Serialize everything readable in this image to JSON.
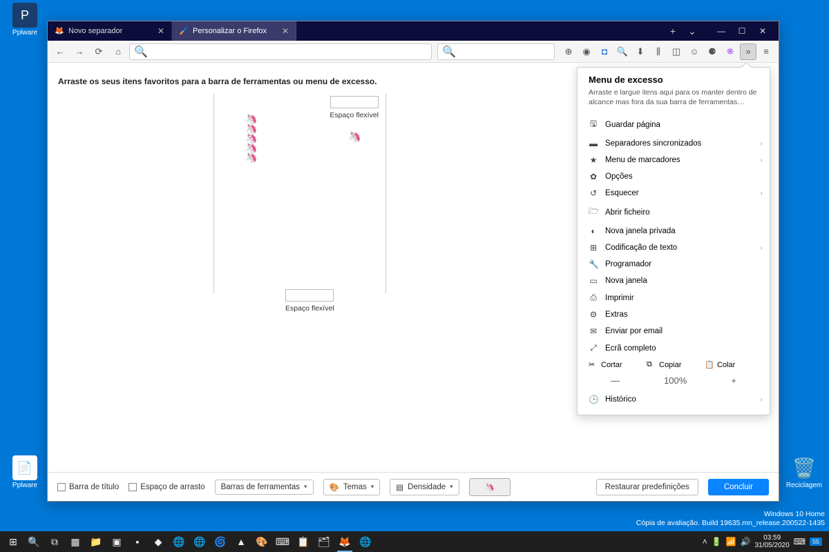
{
  "desktop": {
    "icon1": "Pplware",
    "icon2": "Pplware",
    "icon3": "Reciclagem"
  },
  "tabs": [
    {
      "label": "Novo separador"
    },
    {
      "label": "Personalizar o Firefox"
    }
  ],
  "tabbar_plus": "+",
  "content": {
    "instruction": "Arraste os seus itens favoritos para a barra de ferramentas ou menu de excesso.",
    "flex_space": "Espaço flexível"
  },
  "panel": {
    "title": "Menu de excesso",
    "desc": "Arraste e largue itens aqui para os manter dentro de alcance mas fora da sua barra de ferramentas…",
    "items": [
      {
        "icon": "save-icon",
        "glyph": "🖫",
        "label": "Guardar página"
      },
      {
        "icon": "synced-tabs-icon",
        "glyph": "▬",
        "label": "Separadores sincronizados",
        "chev": true
      },
      {
        "icon": "bookmarks-icon",
        "glyph": "★",
        "label": "Menu de marcadores",
        "chev": true
      },
      {
        "icon": "settings-icon",
        "glyph": "✿",
        "label": "Opções"
      },
      {
        "icon": "forget-icon",
        "glyph": "↺",
        "label": "Esquecer",
        "chev": true
      },
      {
        "icon": "open-file-icon",
        "glyph": "🗁",
        "label": "Abrir ficheiro"
      },
      {
        "icon": "private-icon",
        "glyph": "◐",
        "label": "Nova janela privada"
      },
      {
        "icon": "encoding-icon",
        "glyph": "⊞",
        "label": "Codificação de texto",
        "chev": true
      },
      {
        "icon": "developer-icon",
        "glyph": "🔧",
        "label": "Programador"
      },
      {
        "icon": "new-window-icon",
        "glyph": "▭",
        "label": "Nova janela"
      },
      {
        "icon": "print-icon",
        "glyph": "⎙",
        "label": "Imprimir"
      },
      {
        "icon": "addons-icon",
        "glyph": "⚙",
        "label": "Extras"
      },
      {
        "icon": "email-icon",
        "glyph": "✉",
        "label": "Enviar por email"
      },
      {
        "icon": "fullscreen-icon",
        "glyph": "⤢",
        "label": "Ecrã completo"
      }
    ],
    "cut": "Cortar",
    "copy": "Copiar",
    "paste": "Colar",
    "zoom": "100%",
    "history": "Histórico"
  },
  "bottombar": {
    "titlebar": "Barra de título",
    "dragspace": "Espaço de arrasto",
    "toolbars": "Barras de ferramentas",
    "themes": "Temas",
    "density": "Densidade",
    "restore": "Restaurar predefinições",
    "done": "Concluir"
  },
  "corner": {
    "line1": "Windows 10 Home",
    "line2": "Cópia de avaliação. Build 19635.mn_release.200522-1435"
  },
  "tray": {
    "time": "03:59",
    "date": "31/05/2020",
    "notif": "55"
  }
}
